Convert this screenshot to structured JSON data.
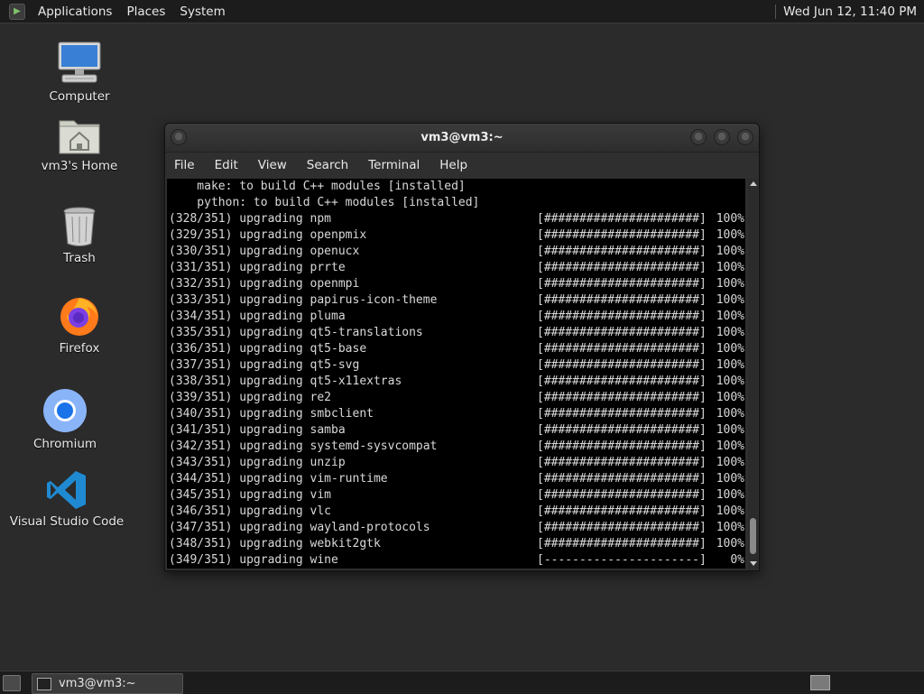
{
  "top_panel": {
    "menus": [
      "Applications",
      "Places",
      "System"
    ],
    "clock": "Wed Jun 12, 11:40 PM"
  },
  "desktop": {
    "icons": [
      {
        "label": "Computer",
        "icon": "computer-icon"
      },
      {
        "label": "vm3's Home",
        "icon": "home-folder-icon"
      },
      {
        "label": "Trash",
        "icon": "trash-icon"
      },
      {
        "label": "Firefox",
        "icon": "firefox-icon"
      },
      {
        "label": "Chromium",
        "icon": "chromium-icon"
      },
      {
        "label": "Visual Studio Code",
        "icon": "vscode-icon"
      }
    ]
  },
  "terminal": {
    "title": "vm3@vm3:~",
    "menu": [
      "File",
      "Edit",
      "View",
      "Search",
      "Terminal",
      "Help"
    ],
    "header_lines": [
      "    make: to build C++ modules [installed]",
      "    python: to build C++ modules [installed]"
    ],
    "rows": [
      {
        "counter": "(328/351)",
        "action": "upgrading",
        "pkg": "npm",
        "bar": "[######################]",
        "pct": "100%"
      },
      {
        "counter": "(329/351)",
        "action": "upgrading",
        "pkg": "openpmix",
        "bar": "[######################]",
        "pct": "100%"
      },
      {
        "counter": "(330/351)",
        "action": "upgrading",
        "pkg": "openucx",
        "bar": "[######################]",
        "pct": "100%"
      },
      {
        "counter": "(331/351)",
        "action": "upgrading",
        "pkg": "prrte",
        "bar": "[######################]",
        "pct": "100%"
      },
      {
        "counter": "(332/351)",
        "action": "upgrading",
        "pkg": "openmpi",
        "bar": "[######################]",
        "pct": "100%"
      },
      {
        "counter": "(333/351)",
        "action": "upgrading",
        "pkg": "papirus-icon-theme",
        "bar": "[######################]",
        "pct": "100%"
      },
      {
        "counter": "(334/351)",
        "action": "upgrading",
        "pkg": "pluma",
        "bar": "[######################]",
        "pct": "100%"
      },
      {
        "counter": "(335/351)",
        "action": "upgrading",
        "pkg": "qt5-translations",
        "bar": "[######################]",
        "pct": "100%"
      },
      {
        "counter": "(336/351)",
        "action": "upgrading",
        "pkg": "qt5-base",
        "bar": "[######################]",
        "pct": "100%"
      },
      {
        "counter": "(337/351)",
        "action": "upgrading",
        "pkg": "qt5-svg",
        "bar": "[######################]",
        "pct": "100%"
      },
      {
        "counter": "(338/351)",
        "action": "upgrading",
        "pkg": "qt5-x11extras",
        "bar": "[######################]",
        "pct": "100%"
      },
      {
        "counter": "(339/351)",
        "action": "upgrading",
        "pkg": "re2",
        "bar": "[######################]",
        "pct": "100%"
      },
      {
        "counter": "(340/351)",
        "action": "upgrading",
        "pkg": "smbclient",
        "bar": "[######################]",
        "pct": "100%"
      },
      {
        "counter": "(341/351)",
        "action": "upgrading",
        "pkg": "samba",
        "bar": "[######################]",
        "pct": "100%"
      },
      {
        "counter": "(342/351)",
        "action": "upgrading",
        "pkg": "systemd-sysvcompat",
        "bar": "[######################]",
        "pct": "100%"
      },
      {
        "counter": "(343/351)",
        "action": "upgrading",
        "pkg": "unzip",
        "bar": "[######################]",
        "pct": "100%"
      },
      {
        "counter": "(344/351)",
        "action": "upgrading",
        "pkg": "vim-runtime",
        "bar": "[######################]",
        "pct": "100%"
      },
      {
        "counter": "(345/351)",
        "action": "upgrading",
        "pkg": "vim",
        "bar": "[######################]",
        "pct": "100%"
      },
      {
        "counter": "(346/351)",
        "action": "upgrading",
        "pkg": "vlc",
        "bar": "[######################]",
        "pct": "100%"
      },
      {
        "counter": "(347/351)",
        "action": "upgrading",
        "pkg": "wayland-protocols",
        "bar": "[######################]",
        "pct": "100%"
      },
      {
        "counter": "(348/351)",
        "action": "upgrading",
        "pkg": "webkit2gtk",
        "bar": "[######################]",
        "pct": "100%"
      },
      {
        "counter": "(349/351)",
        "action": "upgrading",
        "pkg": "wine",
        "bar": "[----------------------]",
        "pct": "0%"
      }
    ]
  },
  "bottom_panel": {
    "task_label": "vm3@vm3:~"
  }
}
